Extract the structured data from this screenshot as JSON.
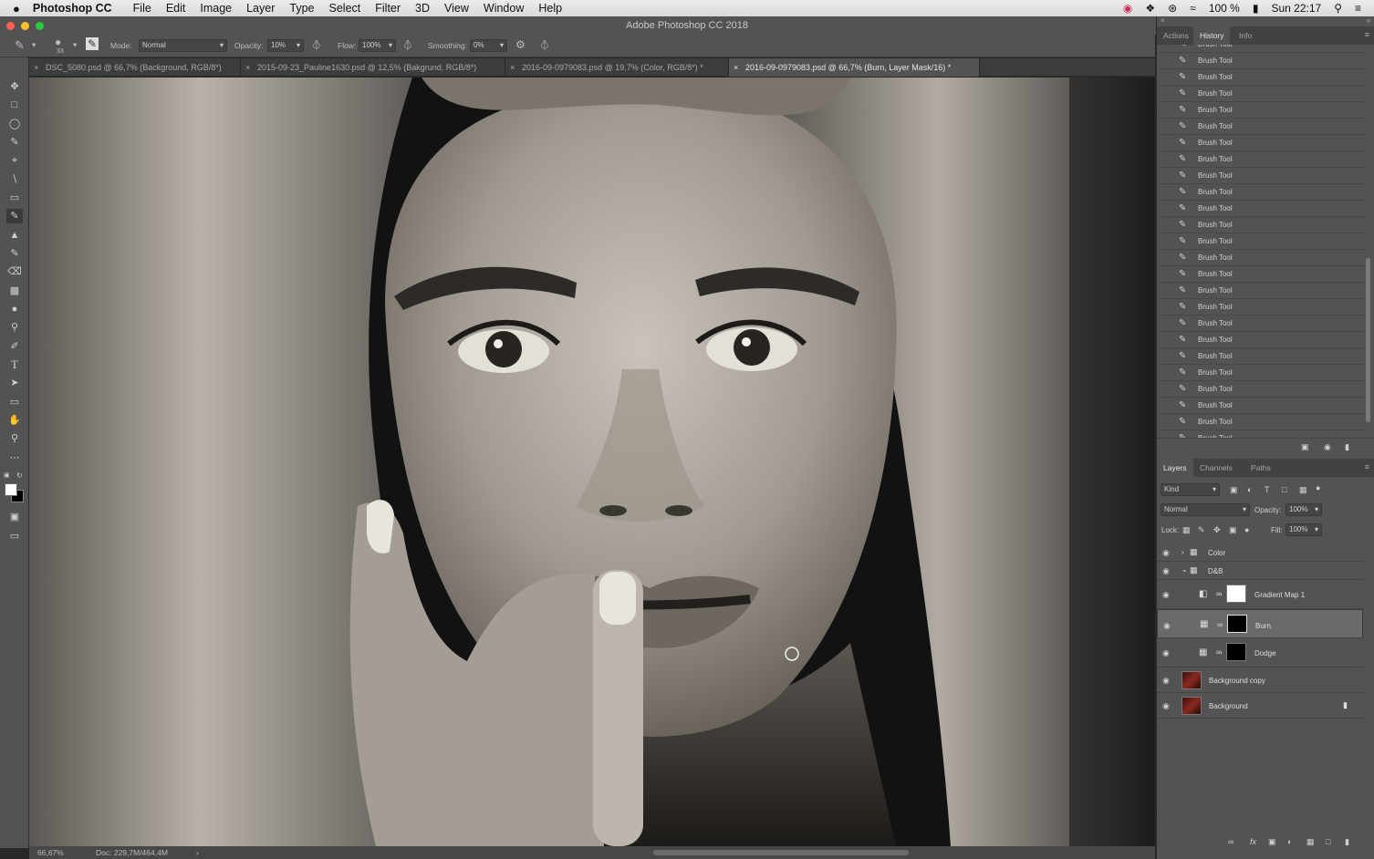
{
  "menubar": {
    "apple": "",
    "app": "Photoshop CC",
    "items": [
      "File",
      "Edit",
      "Image",
      "Layer",
      "Type",
      "Select",
      "Filter",
      "3D",
      "View",
      "Window",
      "Help"
    ],
    "battery": "100 %",
    "clock": "Sun 22:17"
  },
  "window_title": "Adobe Photoshop CC 2018",
  "options": {
    "brush_size": "33",
    "mode_label": "Mode:",
    "mode_value": "Normal",
    "opacity_label": "Opacity:",
    "opacity_value": "10%",
    "flow_label": "Flow:",
    "flow_value": "100%",
    "smoothing_label": "Smoothing:",
    "smoothing_value": "0%"
  },
  "tabs": [
    {
      "label": "DSC_5080.psd @ 66,7% (Background, RGB/8*)",
      "close": "×"
    },
    {
      "label": "2015-09-23_Pauline1630.psd @ 12,5% (Bakgrund, RGB/8*)",
      "close": "×"
    },
    {
      "label": "2016-09-0979083.psd @ 19,7% (Color, RGB/8*) *",
      "close": "×"
    },
    {
      "label": "2016-09-0979083.psd @ 66,7% (Burn, Layer Mask/16) *",
      "close": "×"
    }
  ],
  "status": {
    "zoom": "66,67%",
    "doc": "Doc: 229,7M/464,4M",
    "arrow": "›"
  },
  "history_tabs": [
    "Actions",
    "History",
    "Info"
  ],
  "history_items": [
    "Brush Tool",
    "Brush Tool",
    "Brush Tool",
    "Brush Tool",
    "Brush Tool",
    "Brush Tool",
    "Brush Tool",
    "Brush Tool",
    "Brush Tool",
    "Brush Tool",
    "Brush Tool",
    "Brush Tool",
    "Brush Tool",
    "Brush Tool",
    "Brush Tool",
    "Brush Tool",
    "Brush Tool",
    "Brush Tool",
    "Brush Tool",
    "Brush Tool",
    "Brush Tool",
    "Brush Tool",
    "Brush Tool",
    "Brush Tool",
    "Brush Tool",
    "Brush Tool",
    "Brush Tool"
  ],
  "layers_tabs": [
    "Layers",
    "Channels",
    "Paths"
  ],
  "layers_controls": {
    "kind": "Kind",
    "blend": "Normal",
    "opacity_label": "Opacity:",
    "opacity_value": "100%",
    "lock_label": "Lock:",
    "fill_label": "Fill:",
    "fill_value": "100%"
  },
  "layers": [
    {
      "name": "Color",
      "type": "group"
    },
    {
      "name": "D&B",
      "type": "group"
    },
    {
      "name": "Gradient Map 1",
      "type": "adjustment"
    },
    {
      "name": "Burn",
      "type": "adjustment"
    },
    {
      "name": "Dodge",
      "type": "adjustment"
    },
    {
      "name": "Background copy",
      "type": "pixel"
    },
    {
      "name": "Background",
      "type": "pixel"
    }
  ],
  "icons": [
    "apple-icon",
    "brush-tool-icon",
    "move-tool-icon",
    "marquee-tool-icon",
    "lasso-tool-icon",
    "quick-select-icon",
    "crop-tool-icon",
    "eyedropper-icon",
    "healing-brush-icon",
    "stamp-tool-icon",
    "history-brush-icon",
    "eraser-icon",
    "gradient-tool-icon",
    "blur-tool-icon",
    "dodge-tool-icon",
    "pen-tool-icon",
    "type-tool-icon",
    "path-select-icon",
    "rectangle-tool-icon",
    "hand-tool-icon",
    "zoom-tool-icon",
    "eye-icon",
    "folder-icon",
    "lock-icon",
    "trash-icon",
    "camera-icon",
    "new-layer-icon"
  ]
}
